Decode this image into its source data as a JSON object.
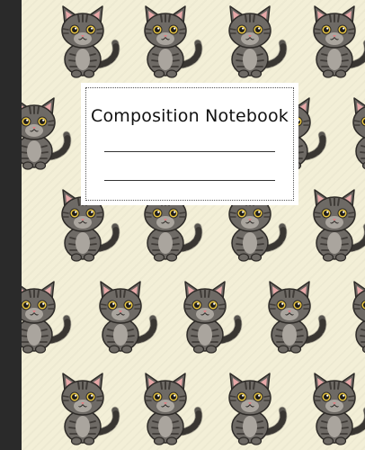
{
  "cover": {
    "title": "Composition Notebook",
    "background_color": "#f3efd7",
    "spine_color": "#2a2a2a",
    "pattern_icon": "gray-tabby-cat-icon",
    "cat_colors": {
      "fur": "#6e6a65",
      "belly": "#aaa59e",
      "stripe": "#403c38",
      "ear_inner": "#e7a8a8",
      "eye": "#e9c642"
    }
  }
}
